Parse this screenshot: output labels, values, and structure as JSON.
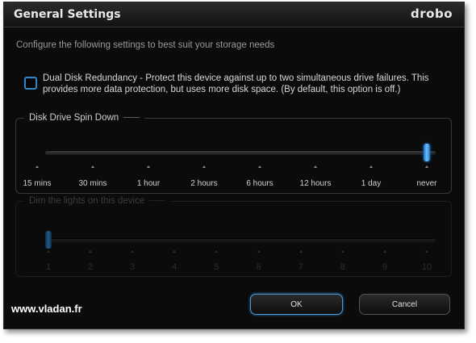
{
  "window": {
    "title": "General Settings",
    "logo_text": "drobo"
  },
  "intro_text": "Configure the following settings to best suit your storage needs",
  "redundancy": {
    "checked": false,
    "label": "Dual Disk Redundancy - Protect this device against up to two simultaneous drive failures. This provides more data protection, but uses more disk space. (By default, this option is off.)"
  },
  "spin_down": {
    "legend": "Disk Drive Spin Down",
    "selected_index": 7,
    "options": [
      "15 mins",
      "30 mins",
      "1 hour",
      "2 hours",
      "6 hours",
      "12 hours",
      "1 day",
      "never"
    ]
  },
  "dim_lights": {
    "legend": "Dim the lights on this device",
    "enabled": false,
    "selected_index": 0,
    "options": [
      "1",
      "2",
      "3",
      "4",
      "5",
      "6",
      "7",
      "8",
      "9",
      "10"
    ]
  },
  "buttons": {
    "ok": "OK",
    "cancel": "Cancel"
  },
  "watermark": "www.vladan.fr",
  "colors": {
    "accent": "#2f86c8",
    "background": "#0b0b0b",
    "text": "#d9d9d9"
  }
}
